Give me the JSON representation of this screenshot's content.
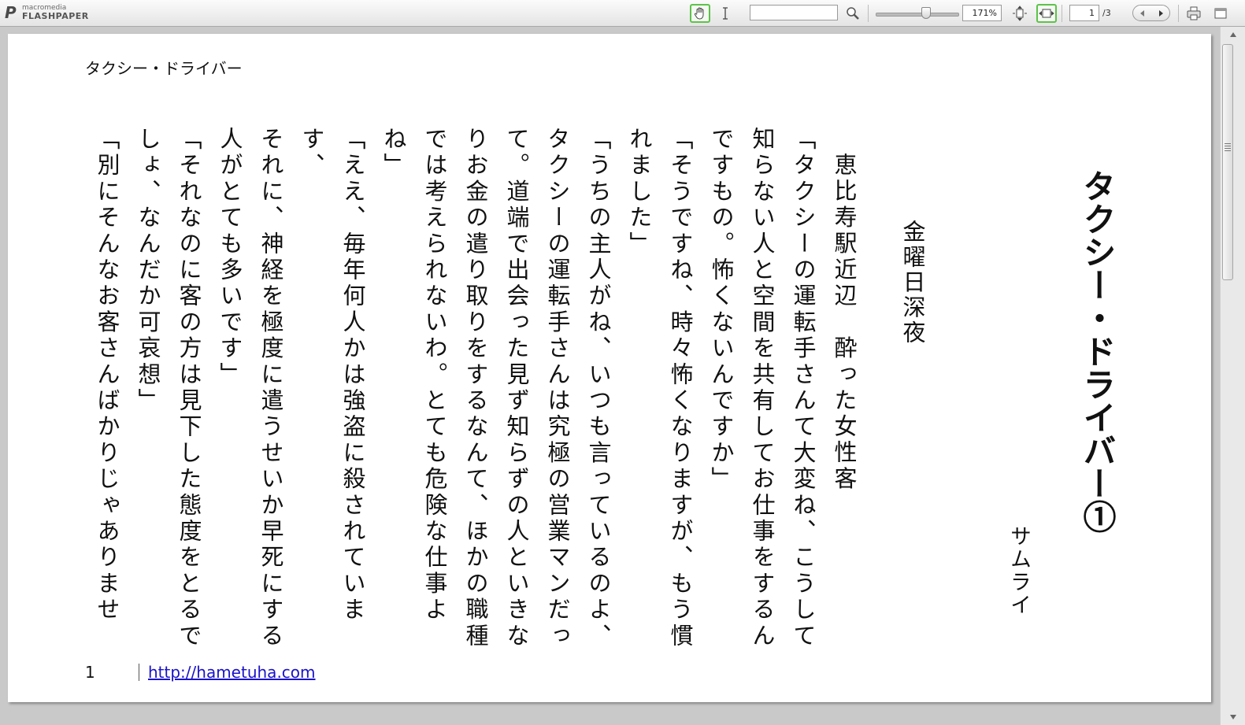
{
  "app": {
    "brand": "macromedia",
    "product": "FLASHPAPER"
  },
  "toolbar": {
    "tools": [
      {
        "name": "hand-tool",
        "icon": "hand-icon",
        "active": true
      },
      {
        "name": "text-select-tool",
        "icon": "text-cursor-icon",
        "active": false
      }
    ],
    "search": {
      "value": "",
      "icon": "magnifier-icon"
    },
    "zoom": {
      "value": "171%",
      "slider_level_percent": 62
    },
    "fit_buttons": [
      {
        "name": "fit-height",
        "icon": "fit-height-icon",
        "active": false
      },
      {
        "name": "fit-width",
        "icon": "fit-width-icon",
        "active": true
      }
    ],
    "page": {
      "current": "1",
      "total": "/3"
    },
    "nav": {
      "prev_icon": "arrow-left-icon",
      "next_icon": "arrow-right-icon"
    },
    "actions": [
      {
        "name": "print",
        "icon": "printer-icon"
      },
      {
        "name": "window",
        "icon": "window-icon"
      }
    ],
    "accent_color": "#5ec24a"
  },
  "document": {
    "running_title": "タクシー・ドライバー",
    "title": "タクシー・ドライバー①",
    "author": "サムライ",
    "scene_heading": "金曜日深夜",
    "body_lines": [
      "恵比寿駅近辺　酔った女性客",
      "「タクシーの運転手さんて大変ね、こうして",
      "知らない人と空間を共有してお仕事をするん",
      "ですもの。怖くないんですか」",
      "「そうですね、時々怖くなりますが、もう慣",
      "れました」",
      "「うちの主人がね、いつも言っているのよ、",
      "タクシーの運転手さんは究極の営業マンだっ",
      "て。道端で出会った見ず知らずの人といきな",
      "りお金の遣り取りをするなんて、ほかの職種",
      "では考えられないわ。とても危険な仕事よね」",
      "「ええ、毎年何人かは強盗に殺されています、",
      "それに、神経を極度に遣うせいか早死にする",
      "人がとても多いです」",
      "「それなのに客の方は見下した態度をとるで",
      "しょ、なんだか可哀想」",
      "「別にそんなお客さんばかりじゃありませ"
    ],
    "page_number": "1",
    "footer_link": "http://hametuha.com",
    "link_color": "#1a12c8"
  }
}
